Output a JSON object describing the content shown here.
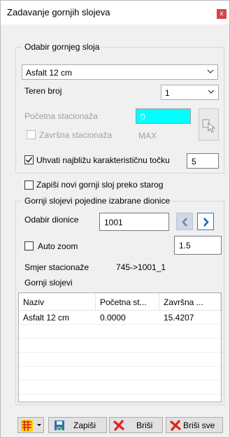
{
  "window": {
    "title": "Zadavanje gornjih slojeva",
    "close_label": "x"
  },
  "odabir_group": {
    "label": "Odabir gornjeg sloja",
    "layer_select": {
      "value": "Asfalt 12 cm"
    },
    "teren_label": "Teren broj",
    "teren_select": {
      "value": "1"
    },
    "pocetna_label": "Početna stacionaža",
    "pocetna_value": "0",
    "zavrsna_label": "Završna stacionaža",
    "zavrsna_value": "MAX",
    "uhvati_label": "Uhvati najbližu karakterističnu točku",
    "uhvati_value": "5",
    "colors": {
      "pocetna_bg": "#00ffff"
    }
  },
  "zapisi_novi_label": "Zapiši novi gornji sloj preko starog",
  "dionice_group": {
    "label": "Gornji slojevi pojedine izabrane dionice",
    "odabir_dionice_label": "Odabir dionice",
    "dionica_value": "1001",
    "auto_zoom_label": "Auto zoom",
    "zoom_value": "1.5",
    "smjer_label": "Smjer stacionaže",
    "smjer_value": "745->1001_1",
    "gornji_label": "Gornji slojevi",
    "table": {
      "columns": [
        "Naziv",
        "Početna st...",
        "Završna ..."
      ],
      "rows": [
        [
          "Asfalt 12 cm",
          "0.0000",
          "15.4207"
        ]
      ]
    }
  },
  "bottom": {
    "zapisi_label": "Zapiši",
    "brisi_label": "Briši",
    "brisi_sve_label": "Briši sve"
  }
}
